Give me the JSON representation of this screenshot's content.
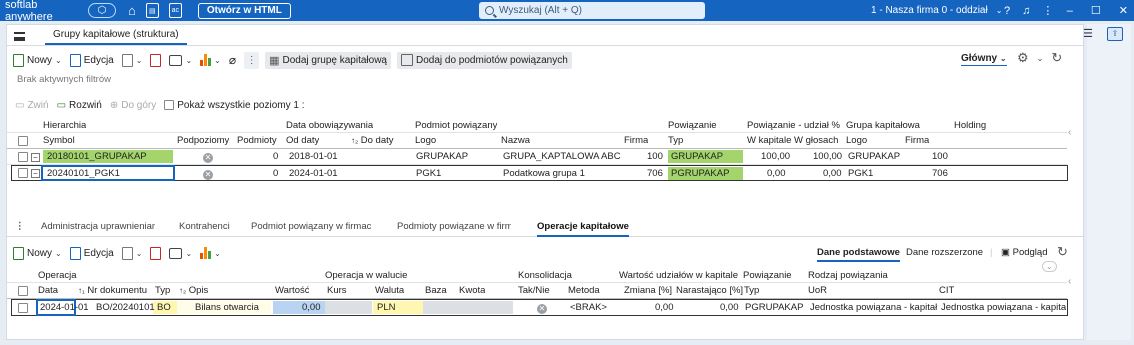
{
  "titlebar": {
    "app_name": "softlab anywhere",
    "html_button": "Otwórz w HTML",
    "search_placeholder": "Wyszukaj (Alt + Q)",
    "company": "1 - Nasza firma 0 - oddział"
  },
  "main_tab": "Grupy kapitałowe (struktura)",
  "toolbar": {
    "new": "Nowy",
    "edit": "Edycja",
    "add_group": "Dodaj grupę kapitałową",
    "add_related": "Dodaj do podmiotów powiązanych",
    "view": "Główny"
  },
  "filters_text": "Brak aktywnych filtrów",
  "tree_toolbar": {
    "collapse": "Zwiń",
    "expand": "Rozwiń",
    "up": "Do góry",
    "show_all": "Pokaż wszystkie poziomy 1 :"
  },
  "upper_grid": {
    "group_headers": {
      "hierarchy": "Hierarchia",
      "validity": "Data obowiązywania",
      "related_entity": "Podmiot powiązany",
      "relation": "Powiązanie",
      "share": "Powiązanie - udział %",
      "capital_group": "Grupa kapitałowa",
      "holding": "Holding"
    },
    "columns": {
      "symbol": "Symbol",
      "sublevels": "Podpoziomy",
      "entities": "Podmioty",
      "from": "Od daty",
      "to": "Do daty",
      "logo": "Logo",
      "name": "Nazwa",
      "firm": "Firma",
      "type": "Typ",
      "w_capital": "W kapitale",
      "w_votes": "W głosach",
      "g_logo": "Logo",
      "g_firm": "Firma"
    },
    "rows": [
      {
        "symbol": "20180101_GRUPAKAP",
        "entities": "0",
        "from": "2018-01-01",
        "to": "",
        "logo": "GRUPAKAP",
        "name": "GRUPA_KAPTALOWA ABC",
        "firm": "100",
        "type": "GRUPAKAP",
        "w_capital": "100,00",
        "w_votes": "100,00",
        "g_logo": "GRUPAKAP",
        "g_firm": "100"
      },
      {
        "symbol": "20240101_PGK1",
        "entities": "0",
        "from": "2024-01-01",
        "to": "",
        "logo": "PGK1",
        "name": "Podatkowa grupa 1",
        "firm": "706",
        "type": "PGRUPAKAP",
        "w_capital": "0,00",
        "w_votes": "0,00",
        "g_logo": "PGK1",
        "g_firm": "706"
      }
    ]
  },
  "bottom_tabs": [
    "Administracja uprawnieniami",
    "Kontrahenci",
    "Podmiot powiązany w firmach",
    "Podmioty powiązane w firmie",
    "Operacje kapitałowe"
  ],
  "bottom_toolbar": {
    "new": "Nowy",
    "edit": "Edycja",
    "basic": "Dane podstawowe",
    "extended": "Dane rozszerzone",
    "preview": "Podgląd"
  },
  "lower_grid": {
    "group_headers": {
      "operation": "Operacja",
      "currency_op": "Operacja w walucie",
      "consolidation": "Konsolidacja",
      "capital_value": "Wartość udziałów w kapitale",
      "relation": "Powiązanie",
      "relation_kind": "Rodzaj powiązania"
    },
    "columns": {
      "date": "Data",
      "doc_no": "Nr dokumentu",
      "type": "Typ",
      "desc": "Opis",
      "value": "Wartość",
      "rate": "Kurs",
      "currency": "Waluta",
      "base": "Baza",
      "amount": "Kwota",
      "yesno": "Tak/Nie",
      "method": "Metoda",
      "change": "Zmiana [%]",
      "cumulative": "Narastająco [%]",
      "rel_type": "Typ",
      "uor": "UoR",
      "cit": "CIT"
    },
    "rows": [
      {
        "date": "2024-01-01",
        "doc_no": "BO/20240101",
        "type": "BO",
        "desc": "Bilans otwarcia",
        "value": "0,00",
        "currency": "PLN",
        "method": "<BRAK>",
        "change": "0,00",
        "cumulative": "0,00",
        "rel_type": "PGRUPAKAP",
        "uor": "Jednostka powiązana - kapitałow",
        "cit": "Jednostka powiązana - kapitałc"
      }
    ]
  }
}
